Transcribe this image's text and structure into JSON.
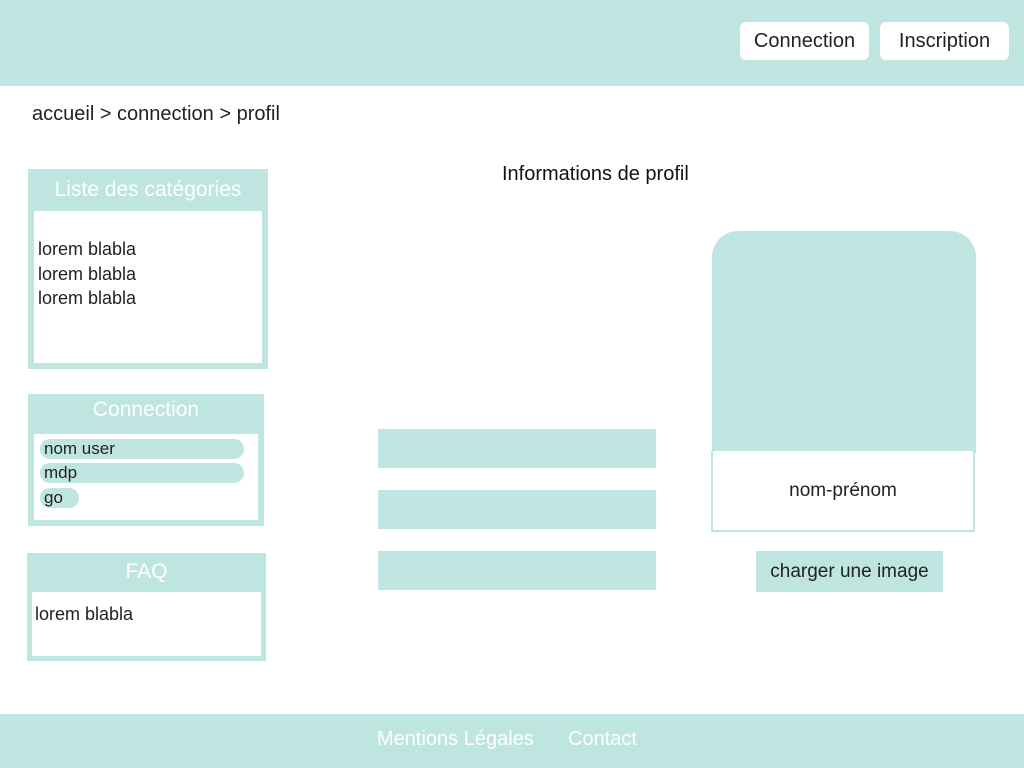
{
  "header": {
    "login_button": "Connection",
    "signup_button": "Inscription"
  },
  "breadcrumb": "accueil > connection > profil",
  "sidebar": {
    "categories": {
      "title": "Liste des catégories",
      "items": [
        "lorem blabla",
        "lorem blabla",
        "lorem blabla"
      ]
    },
    "login": {
      "title": "Connection",
      "username_value": "nom user",
      "password_value": "mdp",
      "submit_label": "go"
    },
    "faq": {
      "title": "FAQ",
      "text": "lorem blabla"
    }
  },
  "main": {
    "title": "Informations de profil",
    "profile_name": "nom-prénom",
    "upload_button": "charger une image"
  },
  "footer": {
    "links": [
      "Mentions Légales",
      "Contact"
    ]
  },
  "colors": {
    "accent": "#bfe5e0",
    "background": "#ffffff",
    "text": "#222222",
    "on_accent_text": "#ffffff"
  }
}
